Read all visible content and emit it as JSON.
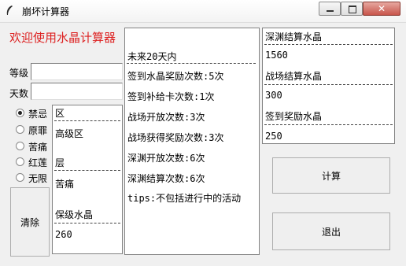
{
  "window": {
    "title": "崩坏计算器"
  },
  "welcome": "欢迎使用水晶计算器",
  "form": {
    "level_label": "等级",
    "level_value": "",
    "days_label": "天数",
    "days_value": ""
  },
  "radios": [
    {
      "label": "禁忌",
      "checked": true
    },
    {
      "label": "原罪",
      "checked": false
    },
    {
      "label": "苦痛",
      "checked": false
    },
    {
      "label": "红莲",
      "checked": false
    },
    {
      "label": "无限",
      "checked": false
    }
  ],
  "clear_button": "清除",
  "info_panel": {
    "zone_label": "区",
    "zone_value": "高级区",
    "tier_label": "层",
    "tier_value": "苦痛",
    "floor_crystal_label": "保级水晶",
    "floor_crystal_value": "260"
  },
  "result_panel": {
    "header": "未来20天内",
    "lines": [
      "签到水晶奖励次数:5次",
      "签到补给卡次数:1次",
      "战场开放次数:3次",
      "战场获得奖励次数:3次",
      "深渊开放次数:6次",
      "深渊结算次数:6次",
      "tips:不包括进行中的活动"
    ]
  },
  "crystal_panel": {
    "abyss_label": "深渊结算水晶",
    "abyss_value": "1560",
    "battlefield_label": "战场结算水晶",
    "battlefield_value": "300",
    "signin_label": "签到奖励水晶",
    "signin_value": "250"
  },
  "buttons": {
    "calculate": "计算",
    "exit": "退出"
  }
}
